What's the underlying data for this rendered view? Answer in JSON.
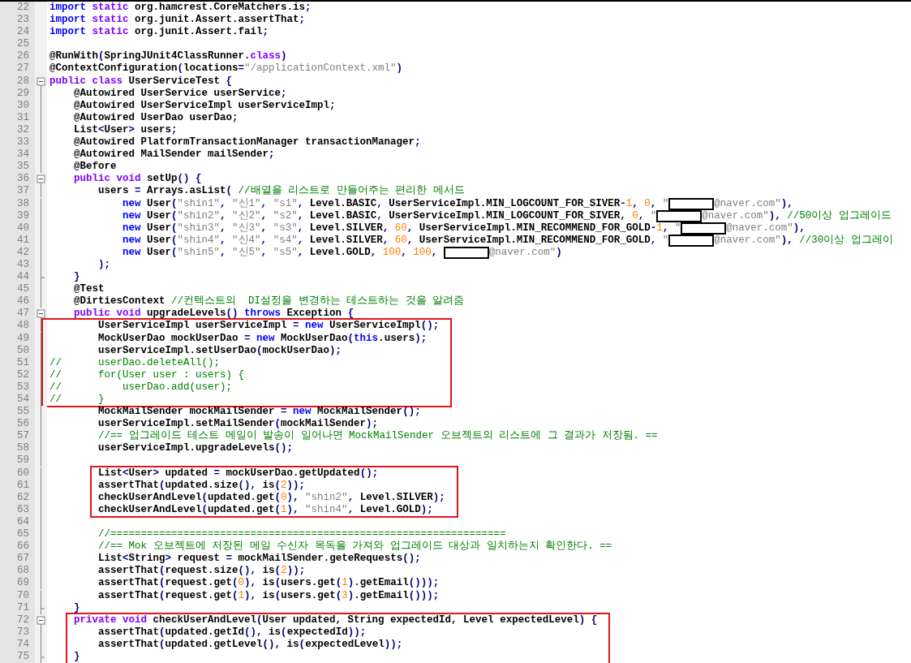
{
  "editor": {
    "segments": [
      {
        "highlighted": false,
        "lines": [
          {
            "number": "22",
            "tokens": [
              {
                "kind": "kw",
                "text": "import"
              },
              {
                "kind": "mod",
                "text": " static"
              },
              {
                "kind": "id",
                "text": " org.hamcrest.CoreMatchers.is"
              },
              {
                "kind": "op",
                "text": ";"
              }
            ]
          },
          {
            "number": "23",
            "tokens": [
              {
                "kind": "kw",
                "text": "import"
              },
              {
                "kind": "mod",
                "text": " static"
              },
              {
                "kind": "id",
                "text": " org.junit.Assert.assertThat"
              },
              {
                "kind": "op",
                "text": ";"
              }
            ]
          },
          {
            "number": "24",
            "tokens": [
              {
                "kind": "kw",
                "text": "import"
              },
              {
                "kind": "mod",
                "text": " static"
              },
              {
                "kind": "id",
                "text": " org.junit.Assert.fail"
              },
              {
                "kind": "op",
                "text": ";"
              }
            ]
          },
          {
            "number": "25"
          },
          {
            "number": "26",
            "tokens": [
              {
                "kind": "id",
                "text": "@RunWith"
              },
              {
                "kind": "op",
                "text": "("
              },
              {
                "kind": "id",
                "text": "SpringJUnit4ClassRunner."
              },
              {
                "kind": "mod",
                "text": "class"
              },
              {
                "kind": "op",
                "text": ")"
              }
            ]
          },
          {
            "number": "27",
            "tokens": [
              {
                "kind": "id",
                "text": "@ContextConfiguration"
              },
              {
                "kind": "op",
                "text": "("
              },
              {
                "kind": "id",
                "text": "locations"
              },
              {
                "kind": "op",
                "text": "="
              },
              {
                "kind": "str",
                "text": "\"/applicationContext.xml\""
              },
              {
                "kind": "op",
                "text": ")"
              }
            ]
          },
          {
            "number": "28",
            "fold": {
              "kind": "toggle",
              "expanded": true
            },
            "tokens": [
              {
                "kind": "mod",
                "text": "public"
              },
              {
                "kind": "mod",
                "text": " class"
              },
              {
                "kind": "id",
                "text": " UserServiceTest "
              },
              {
                "kind": "op",
                "text": "{"
              }
            ]
          },
          {
            "number": "29",
            "fold": {
              "kind": "line"
            },
            "tokens": [
              {
                "kind": "id",
                "text": "    @Autowired UserService userService"
              },
              {
                "kind": "op",
                "text": ";"
              }
            ]
          },
          {
            "number": "30",
            "fold": {
              "kind": "line"
            },
            "tokens": [
              {
                "kind": "id",
                "text": "    @Autowired UserServiceImpl userServiceImpl"
              },
              {
                "kind": "op",
                "text": ";"
              }
            ]
          },
          {
            "number": "31",
            "fold": {
              "kind": "line"
            },
            "tokens": [
              {
                "kind": "id",
                "text": "    @Autowired UserDao userDao"
              },
              {
                "kind": "op",
                "text": ";"
              }
            ]
          },
          {
            "number": "32",
            "fold": {
              "kind": "line"
            },
            "tokens": [
              {
                "kind": "id",
                "text": "    List"
              },
              {
                "kind": "op",
                "text": "<"
              },
              {
                "kind": "id",
                "text": "User"
              },
              {
                "kind": "op",
                "text": ">"
              },
              {
                "kind": "id",
                "text": " users"
              },
              {
                "kind": "op",
                "text": ";"
              }
            ]
          },
          {
            "number": "33",
            "fold": {
              "kind": "line"
            },
            "tokens": [
              {
                "kind": "id",
                "text": "    @Autowired PlatformTransactionManager transactionManager"
              },
              {
                "kind": "op",
                "text": ";"
              }
            ]
          },
          {
            "number": "34",
            "fold": {
              "kind": "line"
            },
            "tokens": [
              {
                "kind": "id",
                "text": "    @Autowired MailSender mailSender"
              },
              {
                "kind": "op",
                "text": ";"
              }
            ]
          },
          {
            "number": "35",
            "fold": {
              "kind": "line"
            },
            "tokens": [
              {
                "kind": "id",
                "text": "    @Before"
              }
            ]
          },
          {
            "number": "36",
            "fold": {
              "kind": "toggle",
              "expanded": true
            },
            "tokens": [
              {
                "kind": "mod",
                "text": "    public"
              },
              {
                "kind": "mod",
                "text": " void"
              },
              {
                "kind": "id",
                "text": " setUp"
              },
              {
                "kind": "op",
                "text": "() {"
              }
            ]
          },
          {
            "number": "37",
            "fold": {
              "kind": "line"
            },
            "tokens": [
              {
                "kind": "id",
                "text": "        users "
              },
              {
                "kind": "op",
                "text": "="
              },
              {
                "kind": "id",
                "text": " Arrays.asList"
              },
              {
                "kind": "op",
                "text": "("
              },
              {
                "kind": "cm",
                "text": " //배열을 리스트로 만들어주는 편리한 메서드"
              }
            ]
          },
          {
            "number": "38",
            "fold": {
              "kind": "line"
            },
            "tokens": [
              {
                "kind": "kw",
                "text": "            new"
              },
              {
                "kind": "id",
                "text": " User"
              },
              {
                "kind": "op",
                "text": "("
              },
              {
                "kind": "str",
                "text": "\"shin1\""
              },
              {
                "kind": "op",
                "text": ", "
              },
              {
                "kind": "str",
                "text": "\"신1\""
              },
              {
                "kind": "op",
                "text": ", "
              },
              {
                "kind": "str",
                "text": "\"s1\""
              },
              {
                "kind": "op",
                "text": ", "
              },
              {
                "kind": "id",
                "text": "Level.BASIC"
              },
              {
                "kind": "op",
                "text": ", "
              },
              {
                "kind": "id",
                "text": "UserServiceImpl.MIN_LOGCOUNT_FOR_SIVER"
              },
              {
                "kind": "op",
                "text": "-"
              },
              {
                "kind": "num",
                "text": "1"
              },
              {
                "kind": "op",
                "text": ", "
              },
              {
                "kind": "num",
                "text": "0"
              },
              {
                "kind": "op",
                "text": ", "
              },
              {
                "kind": "str",
                "text": "\""
              },
              {
                "kind": "redact"
              },
              {
                "kind": "str",
                "text": "@naver.com\""
              },
              {
                "kind": "op",
                "text": "),"
              }
            ]
          },
          {
            "number": "39",
            "fold": {
              "kind": "line"
            },
            "tokens": [
              {
                "kind": "kw",
                "text": "            new"
              },
              {
                "kind": "id",
                "text": " User"
              },
              {
                "kind": "op",
                "text": "("
              },
              {
                "kind": "str",
                "text": "\"shin2\""
              },
              {
                "kind": "op",
                "text": ", "
              },
              {
                "kind": "str",
                "text": "\"신2\""
              },
              {
                "kind": "op",
                "text": ", "
              },
              {
                "kind": "str",
                "text": "\"s2\""
              },
              {
                "kind": "op",
                "text": ", "
              },
              {
                "kind": "id",
                "text": "Level.BASIC"
              },
              {
                "kind": "op",
                "text": ", "
              },
              {
                "kind": "id",
                "text": "UserServiceImpl.MIN_LOGCOUNT_FOR_SIVER"
              },
              {
                "kind": "op",
                "text": ", "
              },
              {
                "kind": "num",
                "text": "0"
              },
              {
                "kind": "op",
                "text": ", "
              },
              {
                "kind": "str",
                "text": "\""
              },
              {
                "kind": "redact"
              },
              {
                "kind": "str",
                "text": "@naver.com\""
              },
              {
                "kind": "op",
                "text": "), "
              },
              {
                "kind": "cm",
                "text": "//50이상 업그레이드"
              }
            ]
          },
          {
            "number": "40",
            "fold": {
              "kind": "line"
            },
            "tokens": [
              {
                "kind": "kw",
                "text": "            new"
              },
              {
                "kind": "id",
                "text": " User"
              },
              {
                "kind": "op",
                "text": "("
              },
              {
                "kind": "str",
                "text": "\"shin3\""
              },
              {
                "kind": "op",
                "text": ", "
              },
              {
                "kind": "str",
                "text": "\"신3\""
              },
              {
                "kind": "op",
                "text": ", "
              },
              {
                "kind": "str",
                "text": "\"s3\""
              },
              {
                "kind": "op",
                "text": ", "
              },
              {
                "kind": "id",
                "text": "Level.SILVER"
              },
              {
                "kind": "op",
                "text": ", "
              },
              {
                "kind": "num",
                "text": "60"
              },
              {
                "kind": "op",
                "text": ", "
              },
              {
                "kind": "id",
                "text": "UserServiceImpl.MIN_RECOMMEND_FOR_GOLD"
              },
              {
                "kind": "op",
                "text": "-"
              },
              {
                "kind": "num",
                "text": "1"
              },
              {
                "kind": "op",
                "text": ", "
              },
              {
                "kind": "str",
                "text": "\""
              },
              {
                "kind": "redact"
              },
              {
                "kind": "str",
                "text": "@naver.com\""
              },
              {
                "kind": "op",
                "text": "),"
              }
            ]
          },
          {
            "number": "41",
            "fold": {
              "kind": "line"
            },
            "tokens": [
              {
                "kind": "kw",
                "text": "            new"
              },
              {
                "kind": "id",
                "text": " User"
              },
              {
                "kind": "op",
                "text": "("
              },
              {
                "kind": "str",
                "text": "\"shin4\""
              },
              {
                "kind": "op",
                "text": ", "
              },
              {
                "kind": "str",
                "text": "\"신4\""
              },
              {
                "kind": "op",
                "text": ", "
              },
              {
                "kind": "str",
                "text": "\"s4\""
              },
              {
                "kind": "op",
                "text": ", "
              },
              {
                "kind": "id",
                "text": "Level.SILVER"
              },
              {
                "kind": "op",
                "text": ", "
              },
              {
                "kind": "num",
                "text": "60"
              },
              {
                "kind": "op",
                "text": ", "
              },
              {
                "kind": "id",
                "text": "UserServiceImpl.MIN_RECOMMEND_FOR_GOLD"
              },
              {
                "kind": "op",
                "text": ", "
              },
              {
                "kind": "str",
                "text": "\""
              },
              {
                "kind": "redact"
              },
              {
                "kind": "str",
                "text": "@naver.com\""
              },
              {
                "kind": "op",
                "text": "), "
              },
              {
                "kind": "cm",
                "text": "//30이상 업그레이"
              }
            ]
          },
          {
            "number": "42",
            "fold": {
              "kind": "line"
            },
            "tokens": [
              {
                "kind": "kw",
                "text": "            new"
              },
              {
                "kind": "id",
                "text": " User"
              },
              {
                "kind": "op",
                "text": "("
              },
              {
                "kind": "str",
                "text": "\"shin5\""
              },
              {
                "kind": "op",
                "text": ", "
              },
              {
                "kind": "str",
                "text": "\"신5\""
              },
              {
                "kind": "op",
                "text": ", "
              },
              {
                "kind": "str",
                "text": "\"s5\""
              },
              {
                "kind": "op",
                "text": ", "
              },
              {
                "kind": "id",
                "text": "Level.GOLD"
              },
              {
                "kind": "op",
                "text": ", "
              },
              {
                "kind": "num",
                "text": "100"
              },
              {
                "kind": "op",
                "text": ", "
              },
              {
                "kind": "num",
                "text": "100"
              },
              {
                "kind": "op",
                "text": ", "
              },
              {
                "kind": "redact"
              },
              {
                "kind": "str",
                "text": "@naver.com\""
              },
              {
                "kind": "op",
                "text": ")"
              }
            ]
          },
          {
            "number": "43",
            "fold": {
              "kind": "line"
            },
            "tokens": [
              {
                "kind": "op",
                "text": "        );"
              }
            ]
          },
          {
            "number": "44",
            "fold": {
              "kind": "end"
            },
            "tokens": [
              {
                "kind": "op",
                "text": "    }"
              }
            ]
          },
          {
            "number": "45",
            "fold": {
              "kind": "line"
            },
            "tokens": [
              {
                "kind": "id",
                "text": "    @Test"
              }
            ]
          },
          {
            "number": "46",
            "fold": {
              "kind": "line"
            },
            "tokens": [
              {
                "kind": "id",
                "text": "    @DirtiesContext "
              },
              {
                "kind": "cm",
                "text": "//컨텍스트의  DI설정을 변경하는 테스트하는 것을 알려줌"
              }
            ]
          },
          {
            "number": "47",
            "fold": {
              "kind": "toggle",
              "expanded": true
            },
            "tokens": [
              {
                "kind": "mod",
                "text": "    public"
              },
              {
                "kind": "mod",
                "text": " void"
              },
              {
                "kind": "id",
                "text": " upgradeLevels"
              },
              {
                "kind": "op",
                "text": "()"
              },
              {
                "kind": "kw",
                "text": " throws"
              },
              {
                "kind": "id",
                "text": " Exception "
              },
              {
                "kind": "op",
                "text": "{"
              }
            ]
          }
        ]
      },
      {
        "highlighted": true,
        "lines": [
          {
            "number": "48",
            "fold": {
              "kind": "line"
            },
            "tokens": [
              {
                "kind": "id",
                "text": "        UserServiceImpl userServiceImpl "
              },
              {
                "kind": "op",
                "text": "="
              },
              {
                "kind": "kw",
                "text": " new"
              },
              {
                "kind": "id",
                "text": " UserServiceImpl"
              },
              {
                "kind": "op",
                "text": "();"
              }
            ]
          },
          {
            "number": "49",
            "fold": {
              "kind": "line"
            },
            "tokens": [
              {
                "kind": "id",
                "text": "        MockUserDao mockUserDao "
              },
              {
                "kind": "op",
                "text": "="
              },
              {
                "kind": "kw",
                "text": " new"
              },
              {
                "kind": "id",
                "text": " MockUserDao"
              },
              {
                "kind": "op",
                "text": "("
              },
              {
                "kind": "kw",
                "text": "this"
              },
              {
                "kind": "id",
                "text": ".users"
              },
              {
                "kind": "op",
                "text": ");"
              }
            ]
          },
          {
            "number": "50",
            "fold": {
              "kind": "line"
            },
            "tokens": [
              {
                "kind": "id",
                "text": "        userServiceImpl.setUserDao"
              },
              {
                "kind": "op",
                "text": "("
              },
              {
                "kind": "id",
                "text": "mockUserDao"
              },
              {
                "kind": "op",
                "text": ");"
              }
            ]
          },
          {
            "number": "51",
            "fold": {
              "kind": "line"
            },
            "tokens": [
              {
                "kind": "cm",
                "text": "//      userDao.deleteAll();"
              }
            ]
          },
          {
            "number": "52",
            "fold": {
              "kind": "line"
            },
            "tokens": [
              {
                "kind": "cm",
                "text": "//      for(User user : users) {"
              }
            ]
          },
          {
            "number": "53",
            "fold": {
              "kind": "line"
            },
            "tokens": [
              {
                "kind": "cm",
                "text": "//          userDao.add(user);"
              }
            ]
          },
          {
            "number": "54",
            "fold": {
              "kind": "line"
            },
            "tokens": [
              {
                "kind": "cm",
                "text": "//      }"
              }
            ]
          }
        ]
      },
      {
        "highlighted": false,
        "lines": [
          {
            "number": "55",
            "fold": {
              "kind": "line"
            },
            "tokens": [
              {
                "kind": "id",
                "text": "        MockMailSender mockMailSender "
              },
              {
                "kind": "op",
                "text": "="
              },
              {
                "kind": "kw",
                "text": " new"
              },
              {
                "kind": "id",
                "text": " MockMailSender"
              },
              {
                "kind": "op",
                "text": "();"
              }
            ]
          },
          {
            "number": "56",
            "fold": {
              "kind": "line"
            },
            "tokens": [
              {
                "kind": "id",
                "text": "        userServiceImpl.setMailSender"
              },
              {
                "kind": "op",
                "text": "("
              },
              {
                "kind": "id",
                "text": "mockMailSender"
              },
              {
                "kind": "op",
                "text": ");"
              }
            ]
          },
          {
            "number": "57",
            "fold": {
              "kind": "line"
            },
            "tokens": [
              {
                "kind": "cm",
                "text": "        //== 업그레이드 테스트 메일이 발송이 일어나면 MockMailSender 오브젝트의 리스트에 그 결과가 저장됨. =="
              }
            ]
          },
          {
            "number": "58",
            "fold": {
              "kind": "line"
            },
            "tokens": [
              {
                "kind": "id",
                "text": "        userServiceImpl.upgradeLevels"
              },
              {
                "kind": "op",
                "text": "();"
              }
            ]
          },
          {
            "number": "59",
            "fold": {
              "kind": "line"
            }
          }
        ]
      },
      {
        "highlighted": true,
        "lines": [
          {
            "number": "60",
            "fold": {
              "kind": "line"
            },
            "tokens": [
              {
                "kind": "id",
                "text": "        List"
              },
              {
                "kind": "op",
                "text": "<"
              },
              {
                "kind": "id",
                "text": "User"
              },
              {
                "kind": "op",
                "text": ">"
              },
              {
                "kind": "id",
                "text": " updated "
              },
              {
                "kind": "op",
                "text": "="
              },
              {
                "kind": "id",
                "text": " mockUserDao.getUpdated"
              },
              {
                "kind": "op",
                "text": "();"
              }
            ]
          },
          {
            "number": "61",
            "fold": {
              "kind": "line"
            },
            "tokens": [
              {
                "kind": "id",
                "text": "        assertThat"
              },
              {
                "kind": "op",
                "text": "("
              },
              {
                "kind": "id",
                "text": "updated.size"
              },
              {
                "kind": "op",
                "text": "(),"
              },
              {
                "kind": "id",
                "text": " is"
              },
              {
                "kind": "op",
                "text": "("
              },
              {
                "kind": "num",
                "text": "2"
              },
              {
                "kind": "op",
                "text": "));"
              }
            ]
          },
          {
            "number": "62",
            "fold": {
              "kind": "line"
            },
            "tokens": [
              {
                "kind": "id",
                "text": "        checkUserAndLevel"
              },
              {
                "kind": "op",
                "text": "("
              },
              {
                "kind": "id",
                "text": "updated.get"
              },
              {
                "kind": "op",
                "text": "("
              },
              {
                "kind": "num",
                "text": "0"
              },
              {
                "kind": "op",
                "text": "), "
              },
              {
                "kind": "str",
                "text": "\"shin2\""
              },
              {
                "kind": "op",
                "text": ", "
              },
              {
                "kind": "id",
                "text": "Level.SILVER"
              },
              {
                "kind": "op",
                "text": ");"
              }
            ]
          },
          {
            "number": "63",
            "fold": {
              "kind": "line"
            },
            "tokens": [
              {
                "kind": "id",
                "text": "        checkUserAndLevel"
              },
              {
                "kind": "op",
                "text": "("
              },
              {
                "kind": "id",
                "text": "updated.get"
              },
              {
                "kind": "op",
                "text": "("
              },
              {
                "kind": "num",
                "text": "1"
              },
              {
                "kind": "op",
                "text": "), "
              },
              {
                "kind": "str",
                "text": "\"shin4\""
              },
              {
                "kind": "op",
                "text": ", "
              },
              {
                "kind": "id",
                "text": "Level.GOLD"
              },
              {
                "kind": "op",
                "text": ");"
              }
            ]
          }
        ]
      },
      {
        "highlighted": false,
        "lines": [
          {
            "number": "64",
            "fold": {
              "kind": "line"
            }
          },
          {
            "number": "65",
            "fold": {
              "kind": "line"
            },
            "tokens": [
              {
                "kind": "cm",
                "text": "        //================================================================="
              }
            ]
          },
          {
            "number": "66",
            "fold": {
              "kind": "line"
            },
            "tokens": [
              {
                "kind": "cm",
                "text": "        //== Mok 오브젝트에 저장된 메일 수신자 목독을 가져와 업그레이드 대상과 일치하는지 확인한다. =="
              }
            ]
          },
          {
            "number": "67",
            "fold": {
              "kind": "line"
            },
            "tokens": [
              {
                "kind": "id",
                "text": "        List"
              },
              {
                "kind": "op",
                "text": "<"
              },
              {
                "kind": "id",
                "text": "String"
              },
              {
                "kind": "op",
                "text": ">"
              },
              {
                "kind": "id",
                "text": " request "
              },
              {
                "kind": "op",
                "text": "="
              },
              {
                "kind": "id",
                "text": " mockMailSender.geteRequests"
              },
              {
                "kind": "op",
                "text": "();"
              }
            ]
          },
          {
            "number": "68",
            "fold": {
              "kind": "line"
            },
            "tokens": [
              {
                "kind": "id",
                "text": "        assertThat"
              },
              {
                "kind": "op",
                "text": "("
              },
              {
                "kind": "id",
                "text": "request.size"
              },
              {
                "kind": "op",
                "text": "(),"
              },
              {
                "kind": "id",
                "text": " is"
              },
              {
                "kind": "op",
                "text": "("
              },
              {
                "kind": "num",
                "text": "2"
              },
              {
                "kind": "op",
                "text": "));"
              }
            ]
          },
          {
            "number": "69",
            "fold": {
              "kind": "line"
            },
            "tokens": [
              {
                "kind": "id",
                "text": "        assertThat"
              },
              {
                "kind": "op",
                "text": "("
              },
              {
                "kind": "id",
                "text": "request.get"
              },
              {
                "kind": "op",
                "text": "("
              },
              {
                "kind": "num",
                "text": "0"
              },
              {
                "kind": "op",
                "text": "),"
              },
              {
                "kind": "id",
                "text": " is"
              },
              {
                "kind": "op",
                "text": "("
              },
              {
                "kind": "id",
                "text": "users.get"
              },
              {
                "kind": "op",
                "text": "("
              },
              {
                "kind": "num",
                "text": "1"
              },
              {
                "kind": "op",
                "text": ")."
              },
              {
                "kind": "id",
                "text": "getEmail"
              },
              {
                "kind": "op",
                "text": "()));"
              }
            ]
          },
          {
            "number": "70",
            "fold": {
              "kind": "line"
            },
            "tokens": [
              {
                "kind": "id",
                "text": "        assertThat"
              },
              {
                "kind": "op",
                "text": "("
              },
              {
                "kind": "id",
                "text": "request.get"
              },
              {
                "kind": "op",
                "text": "("
              },
              {
                "kind": "num",
                "text": "1"
              },
              {
                "kind": "op",
                "text": "),"
              },
              {
                "kind": "id",
                "text": " is"
              },
              {
                "kind": "op",
                "text": "("
              },
              {
                "kind": "id",
                "text": "users.get"
              },
              {
                "kind": "op",
                "text": "("
              },
              {
                "kind": "num",
                "text": "3"
              },
              {
                "kind": "op",
                "text": ")."
              },
              {
                "kind": "id",
                "text": "getEmail"
              },
              {
                "kind": "op",
                "text": "()));"
              }
            ]
          },
          {
            "number": "71",
            "fold": {
              "kind": "end"
            },
            "tokens": [
              {
                "kind": "op",
                "text": "    }"
              }
            ]
          }
        ]
      },
      {
        "highlighted": true,
        "lines": [
          {
            "number": "72",
            "fold": {
              "kind": "toggle",
              "expanded": true
            },
            "tokens": [
              {
                "kind": "mod",
                "text": "    private"
              },
              {
                "kind": "mod",
                "text": " void"
              },
              {
                "kind": "id",
                "text": " checkUserAndLevel"
              },
              {
                "kind": "op",
                "text": "("
              },
              {
                "kind": "id",
                "text": "User updated, String expectedId, Level expectedLevel"
              },
              {
                "kind": "op",
                "text": ") {"
              }
            ]
          },
          {
            "number": "73",
            "fold": {
              "kind": "line"
            },
            "tokens": [
              {
                "kind": "id",
                "text": "        assertThat"
              },
              {
                "kind": "op",
                "text": "("
              },
              {
                "kind": "id",
                "text": "updated.getId"
              },
              {
                "kind": "op",
                "text": "(),"
              },
              {
                "kind": "id",
                "text": " is"
              },
              {
                "kind": "op",
                "text": "("
              },
              {
                "kind": "id",
                "text": "expectedId"
              },
              {
                "kind": "op",
                "text": "));"
              }
            ]
          },
          {
            "number": "74",
            "fold": {
              "kind": "line"
            },
            "tokens": [
              {
                "kind": "id",
                "text": "        assertThat"
              },
              {
                "kind": "op",
                "text": "("
              },
              {
                "kind": "id",
                "text": "updated.getLevel"
              },
              {
                "kind": "op",
                "text": "(),"
              },
              {
                "kind": "id",
                "text": " is"
              },
              {
                "kind": "op",
                "text": "("
              },
              {
                "kind": "id",
                "text": "expectedLevel"
              },
              {
                "kind": "op",
                "text": "));"
              }
            ]
          },
          {
            "number": "75",
            "fold": {
              "kind": "end"
            },
            "tokens": [
              {
                "kind": "op",
                "text": "    }"
              }
            ]
          }
        ]
      }
    ]
  }
}
